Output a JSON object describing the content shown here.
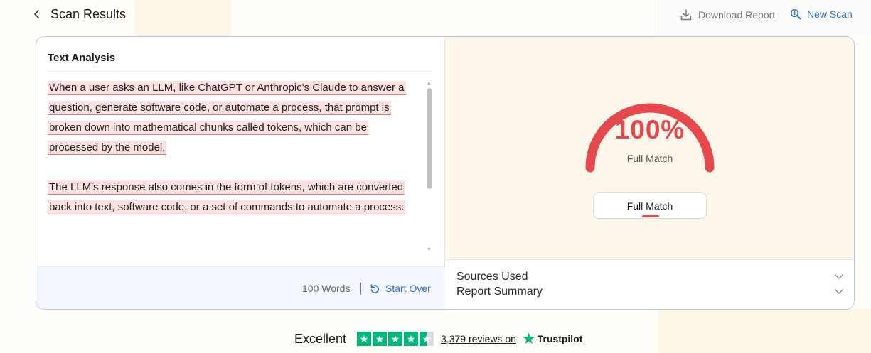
{
  "header": {
    "title": "Scan Results",
    "download_label": "Download Report",
    "new_scan_label": "New Scan"
  },
  "analysis": {
    "title": "Text Analysis",
    "paragraphs": [
      "When a user asks an LLM, like ChatGPT or Anthropic's Claude to answer a question, generate software code, or automate a process, that prompt is broken down into mathematical chunks called tokens, which can be processed by the model.",
      "The LLM's response also comes in the form of tokens, which are converted back into text, software code, or a set of commands to automate a process."
    ],
    "word_count": "100 Words",
    "start_over_label": "Start Over"
  },
  "result": {
    "percent": "100%",
    "percent_value": 100,
    "gauge_caption": "Full Match",
    "match_button_label": "Full Match",
    "accent_color": "#e5484d"
  },
  "accordion": {
    "sources_label": "Sources Used",
    "summary_label": "Report Summary"
  },
  "trust": {
    "rating_word": "Excellent",
    "stars": 4.5,
    "reviews_link": "3,379 reviews on",
    "brand": "Trustpilot"
  }
}
